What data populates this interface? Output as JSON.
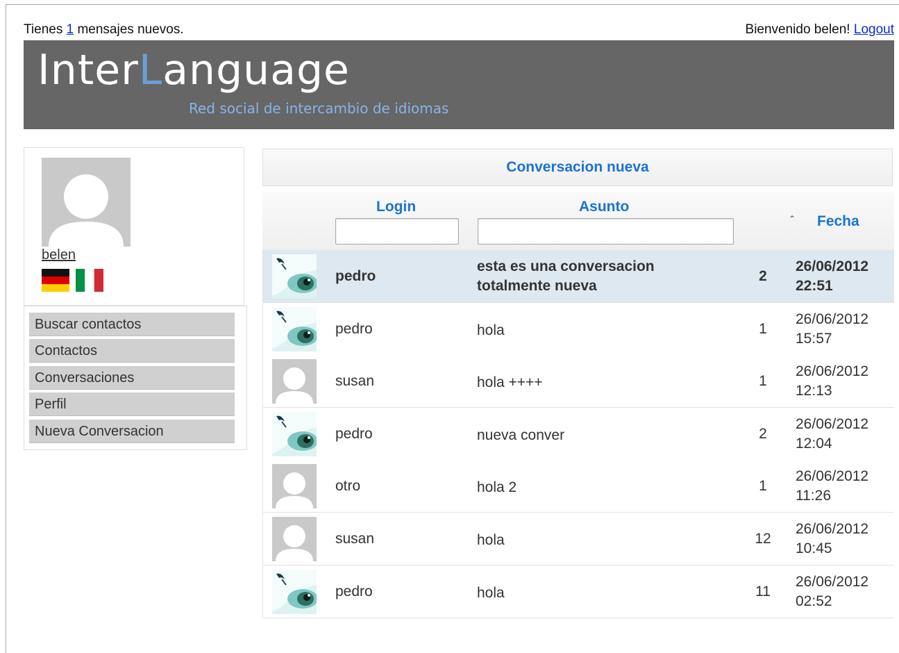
{
  "topbar": {
    "msg_prefix": "Tienes",
    "msg_count": "1",
    "msg_suffix": "mensajes nuevos.",
    "welcome": "Bienvenido belen!",
    "logout": "Logout"
  },
  "header": {
    "logo_part1": "Inter",
    "logo_part2": "L",
    "logo_part3": "anguage",
    "tagline": "Red social de intercambio de idiomas"
  },
  "profile": {
    "username": "belen",
    "flags": [
      "german-flag-icon",
      "italian-flag-icon"
    ]
  },
  "menu": {
    "items": [
      {
        "label": "Buscar contactos"
      },
      {
        "label": "Contactos"
      },
      {
        "label": "Conversaciones"
      },
      {
        "label": "Perfil"
      },
      {
        "label": "Nueva Conversacion"
      }
    ]
  },
  "conversations": {
    "new_label": "Conversacion nueva",
    "columns": {
      "login": "Login",
      "subject": "Asunto",
      "date": "Fecha",
      "login_filter_value": "",
      "subject_filter_value": ""
    },
    "rows": [
      {
        "avatar": "eye-avatar-icon",
        "login": "pedro",
        "subject": "esta es una conversacion totalmente nueva",
        "count": "2",
        "date": "26/06/2012",
        "time": "22:51",
        "selected": true
      },
      {
        "avatar": "eye-avatar-icon",
        "login": "pedro",
        "subject": "hola",
        "count": "1",
        "date": "26/06/2012",
        "time": "15:57"
      },
      {
        "avatar": "default-avatar-icon",
        "login": "susan",
        "subject": "hola ++++",
        "count": "1",
        "date": "26/06/2012",
        "time": "12:13"
      },
      {
        "avatar": "eye-avatar-icon",
        "login": "pedro",
        "subject": "nueva conver",
        "count": "2",
        "date": "26/06/2012",
        "time": "12:04"
      },
      {
        "avatar": "default-avatar-icon",
        "login": "otro",
        "subject": "hola 2",
        "count": "1",
        "date": "26/06/2012",
        "time": "11:26"
      },
      {
        "avatar": "default-avatar-icon",
        "login": "susan",
        "subject": "hola",
        "count": "12",
        "date": "26/06/2012",
        "time": "10:45"
      },
      {
        "avatar": "eye-avatar-icon",
        "login": "pedro",
        "subject": "hola",
        "count": "11",
        "date": "26/06/2012",
        "time": "02:52"
      }
    ]
  },
  "colors": {
    "header_bg": "#666666",
    "accent": "#1a73d1",
    "selected_row": "#dde8f0",
    "menu_bg": "#d0d0d0"
  }
}
